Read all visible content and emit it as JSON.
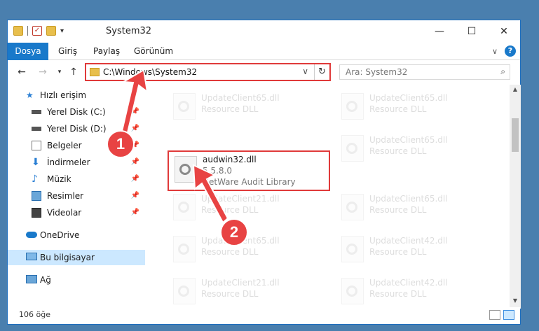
{
  "window": {
    "title": "System32"
  },
  "ribbon": {
    "tabs": [
      "Dosya",
      "Giriş",
      "Paylaş",
      "Görünüm"
    ]
  },
  "address": {
    "path": "C:\\Windows\\System32"
  },
  "search": {
    "placeholder": "Ara: System32"
  },
  "sidebar": {
    "items": [
      {
        "label": "Hızlı erişim",
        "icon": "star-icon"
      },
      {
        "label": "Yerel Disk (C:)",
        "icon": "drive-icon",
        "pinned": true
      },
      {
        "label": "Yerel Disk (D:)",
        "icon": "drive-icon",
        "pinned": true
      },
      {
        "label": "Belgeler",
        "icon": "documents-icon",
        "pinned": true
      },
      {
        "label": "İndirmeler",
        "icon": "download-icon",
        "pinned": true
      },
      {
        "label": "Müzik",
        "icon": "music-icon",
        "pinned": true
      },
      {
        "label": "Resimler",
        "icon": "pictures-icon",
        "pinned": true
      },
      {
        "label": "Videolar",
        "icon": "videos-icon",
        "pinned": true
      },
      {
        "label": "OneDrive",
        "icon": "cloud-icon"
      },
      {
        "label": "Bu bilgisayar",
        "icon": "computer-icon",
        "selected": true
      },
      {
        "label": "Ağ",
        "icon": "network-icon"
      }
    ]
  },
  "files": {
    "left": [
      {
        "name": "UpdateClient65.dll",
        "desc": "Resource DLL"
      },
      {
        "name": "UpdateClient21.dll",
        "desc": "Resource DLL"
      },
      {
        "name": "UpdateClient65.dll",
        "desc": "Resource DLL"
      },
      {
        "name": "UpdateClient21.dll",
        "desc": "Resource DLL"
      }
    ],
    "highlighted": {
      "name": "audwin32.dll",
      "version": "5.5.8.0",
      "desc": "NetWare Audit Library"
    },
    "right": [
      {
        "name": "UpdateClient65.dll",
        "desc": "Resource DLL"
      },
      {
        "name": "UpdateClient65.dll",
        "desc": "Resource DLL"
      },
      {
        "name": "UpdateClient65.dll",
        "desc": "Resource DLL"
      },
      {
        "name": "UpdateClient42.dll",
        "desc": "Resource DLL"
      },
      {
        "name": "UpdateClient42.dll",
        "desc": "Resource DLL"
      }
    ]
  },
  "status": {
    "count": "106 öğe"
  },
  "callouts": {
    "one": "1",
    "two": "2"
  },
  "colors": {
    "accent": "#1979ca",
    "callout": "#e84343"
  }
}
